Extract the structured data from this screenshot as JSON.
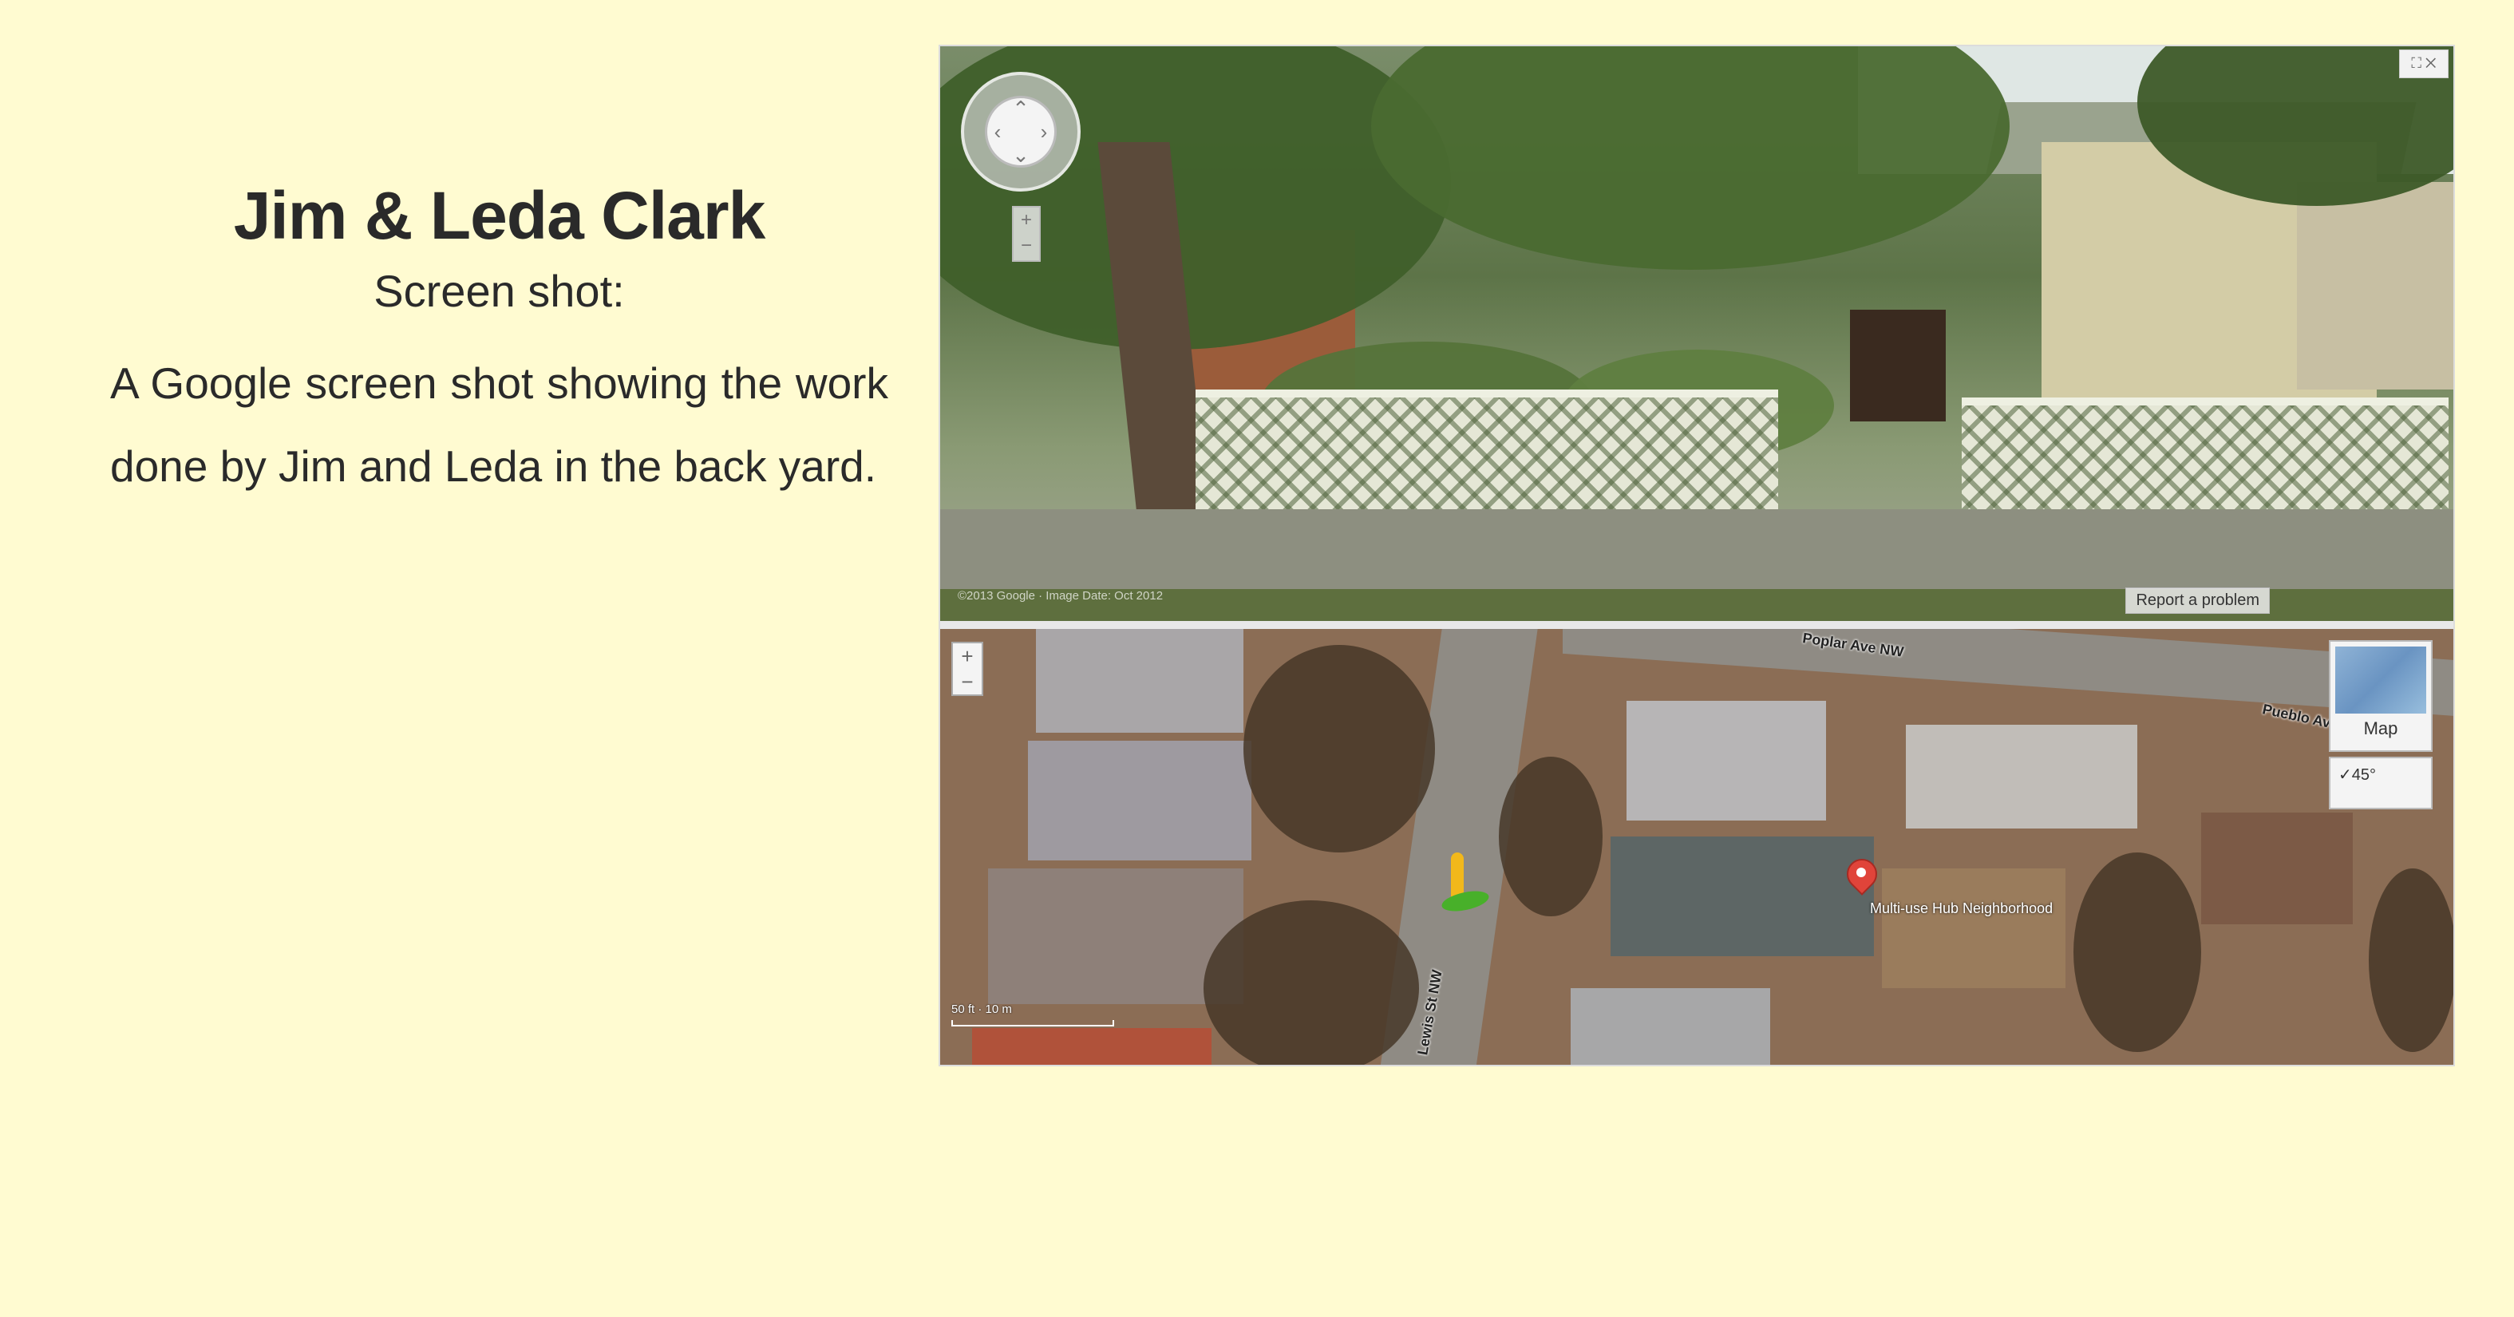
{
  "heading": {
    "title": "Jim & Leda Clark",
    "subtitle": "Screen shot:",
    "description": "A Google screen shot showing the work done by Jim and Leda in the back yard."
  },
  "street_view": {
    "copyright": "©2013 Google · Image Date: Oct 2012",
    "report_link": "Report a problem",
    "corner_controls": "⛶ ✕",
    "nav_arrows": {
      "up": "⌃",
      "down": "⌄",
      "left": "‹",
      "right": "›"
    },
    "zoom": {
      "plus": "+",
      "minus": "−"
    }
  },
  "aerial_map": {
    "street_labels": [
      "Poplar Ave NW",
      "Pueblo Ave",
      "Lewis St NW"
    ],
    "marker_label": "Multi-use Hub Neighborhood",
    "map_type": "Map",
    "angle": "✓45°",
    "zoom": {
      "plus": "+",
      "minus": "−"
    },
    "scale": "50 ft · 10 m"
  },
  "colors": {
    "page_background": "#fffbd1",
    "text": "#2a2a2a",
    "marker": "#e0443a"
  }
}
